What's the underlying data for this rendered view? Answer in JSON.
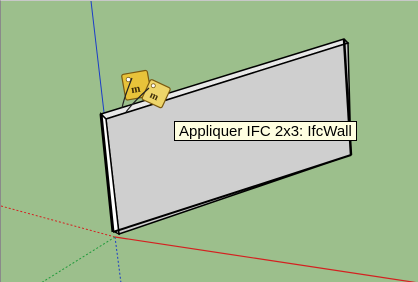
{
  "viewport": {
    "background_color": "#9cbf8c",
    "sky_color": "#9cbf8c",
    "axis_colors": {
      "blue": "#1a3cc8",
      "red": "#d42020",
      "green": "#1f9a3a"
    },
    "wall_face_color": "#cfcfcf",
    "wall_edge_color": "#000000"
  },
  "tool": {
    "icon": "ifc-classifier-tags-icon"
  },
  "tooltip": {
    "text": "Appliquer IFC 2x3: IfcWall"
  }
}
